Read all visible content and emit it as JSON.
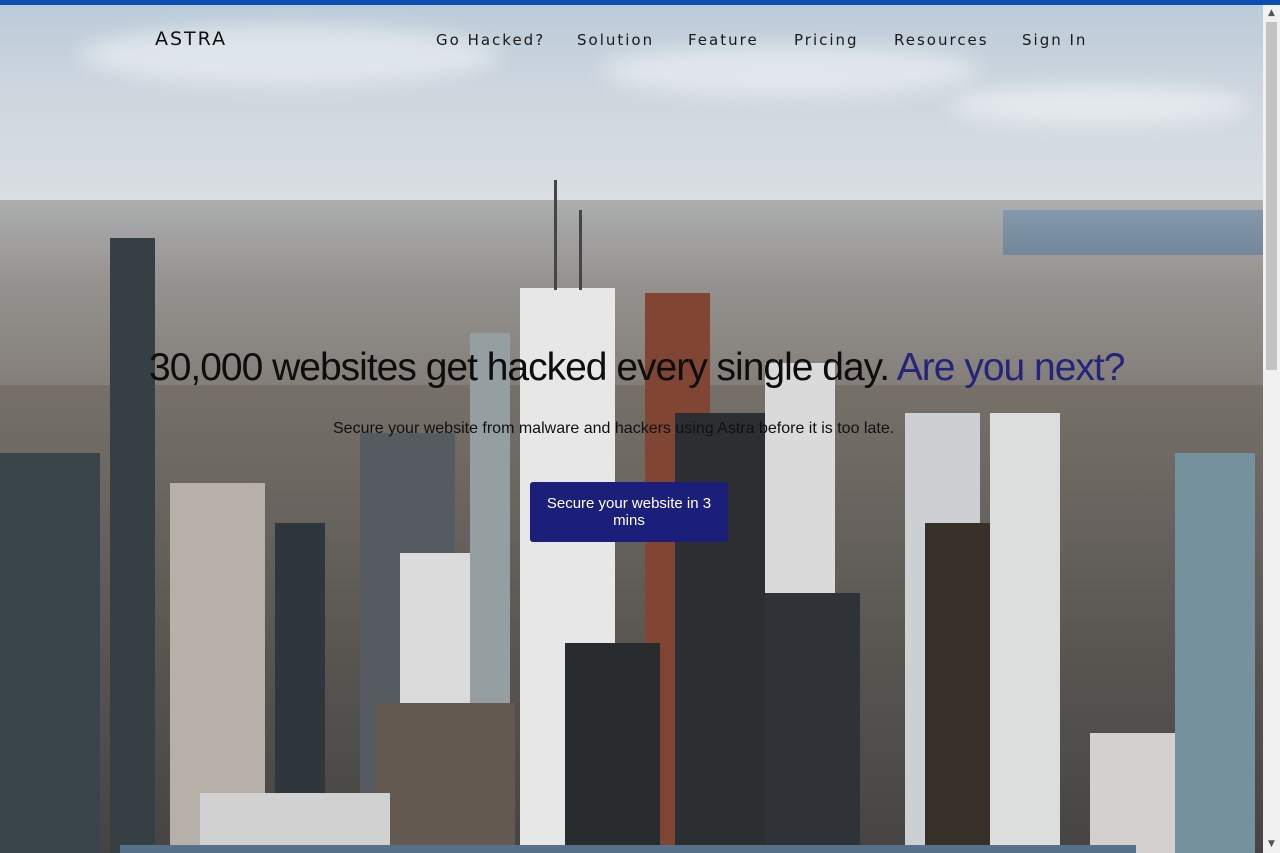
{
  "brand": "ASTRA",
  "nav": [
    "Go Hacked?",
    "Solution",
    "Feature",
    "Pricing",
    "Resources",
    "Sign In"
  ],
  "hero": {
    "headline_main": "30,000 websites get hacked every single day.",
    "headline_accent": "Are you next?",
    "subtitle": "Secure your website from malware and hackers using Astra before it is too late.",
    "cta": "Secure your website in 3 mins"
  },
  "colors": {
    "accent": "#22257a",
    "cta_background": "#1b1f7a",
    "top_bar": "#0b4fb3"
  },
  "background_image": "aerial-city-skyline"
}
